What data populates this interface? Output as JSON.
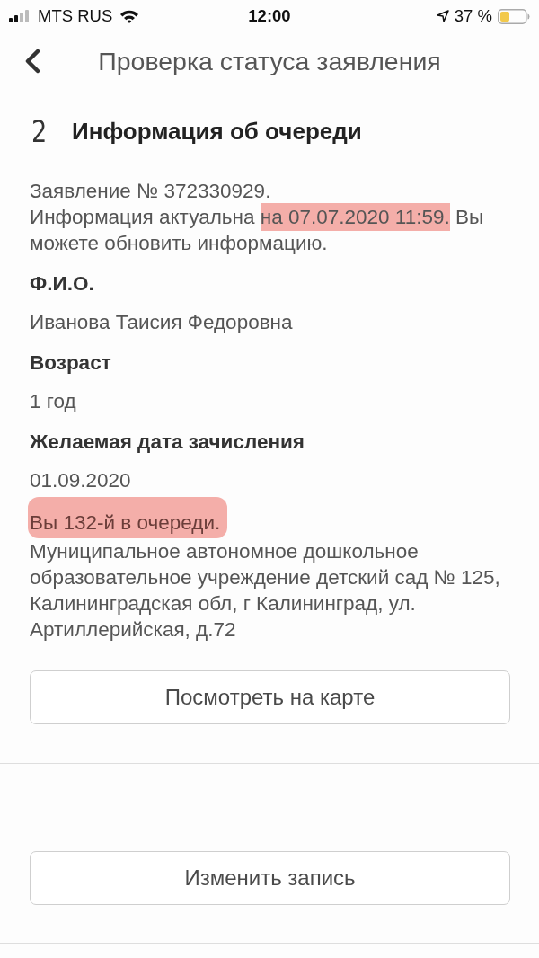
{
  "status_bar": {
    "carrier": "MTS RUS",
    "time": "12:00",
    "battery": "37 %"
  },
  "header": {
    "title": "Проверка статуса заявления"
  },
  "section": {
    "number": "2",
    "title": "Информация об очереди"
  },
  "notice": {
    "application": "Заявление № 372330929.",
    "segments": [
      {
        "text": "Информация актуальна ",
        "highlighted": false
      },
      {
        "text": "на 07.07.2020 11:59.",
        "highlighted": true
      },
      {
        "text": " Вы можете обновить информацию.",
        "highlighted": false
      }
    ]
  },
  "fields": [
    {
      "label": "Ф.И.О.",
      "value": "Иванова Таисия Федоровна"
    },
    {
      "label": "Возраст",
      "value": "1 год"
    },
    {
      "label": "Желаемая дата зачисления",
      "value": "01.09.2020"
    }
  ],
  "queue": {
    "text": "Вы 132-й в очереди.",
    "highlighted": true
  },
  "address": "Муниципальное автономное дошкольное образовательное учреждение детский сад № 125, Калининградская обл, г Калининград, ул. Артиллерийская, д.72",
  "buttons": [
    {
      "label": "Посмотреть на карте"
    },
    {
      "label": "Изменить запись"
    }
  ]
}
